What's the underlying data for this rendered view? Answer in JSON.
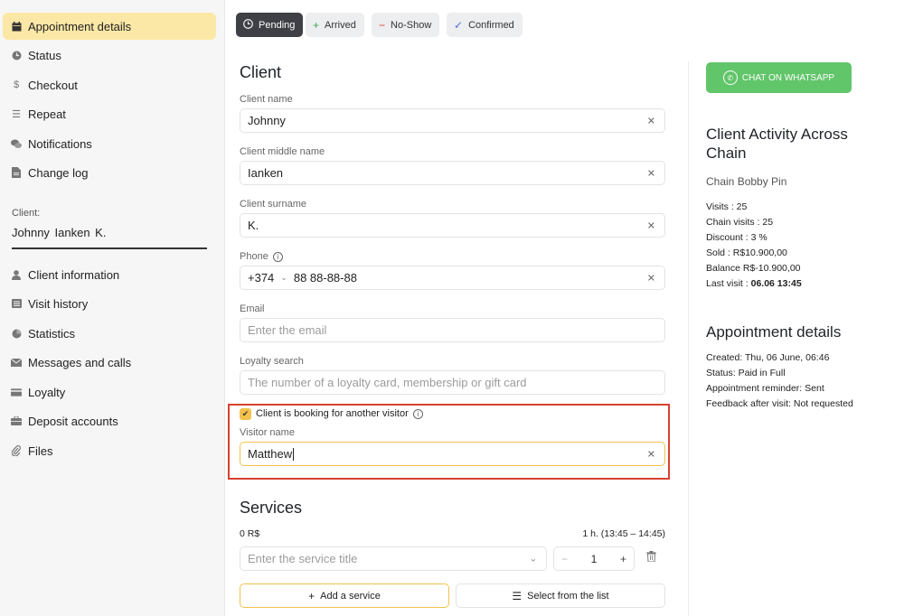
{
  "sidebar": {
    "items": [
      {
        "label": "Appointment details",
        "icon": "calendar-icon"
      },
      {
        "label": "Status",
        "icon": "clock-icon"
      },
      {
        "label": "Checkout",
        "icon": "dollar-icon"
      },
      {
        "label": "Repeat",
        "icon": "list-icon"
      },
      {
        "label": "Notifications",
        "icon": "chat-bubbles-icon"
      },
      {
        "label": "Change log",
        "icon": "document-icon"
      }
    ],
    "client_caption": "Client:",
    "client_name": "Johnny  Ianken K.",
    "client_items": [
      {
        "label": "Client information",
        "icon": "user-icon"
      },
      {
        "label": "Visit history",
        "icon": "history-icon"
      },
      {
        "label": "Statistics",
        "icon": "pie-chart-icon"
      },
      {
        "label": "Messages and calls",
        "icon": "envelope-icon"
      },
      {
        "label": "Loyalty",
        "icon": "card-icon"
      },
      {
        "label": "Deposit accounts",
        "icon": "briefcase-icon"
      },
      {
        "label": "Files",
        "icon": "paperclip-icon"
      }
    ]
  },
  "status_buttons": [
    {
      "label": "Pending",
      "icon": "clock-icon",
      "active": true
    },
    {
      "label": "Arrived",
      "icon": "plus-icon"
    },
    {
      "label": "No-Show",
      "icon": "minus-icon"
    },
    {
      "label": "Confirmed",
      "icon": "check-icon"
    }
  ],
  "colors": {
    "accent": "#f2c14e",
    "active_nav": "#fbe8a6",
    "whatsapp": "#61c56a",
    "highlight": "#d9412f"
  },
  "client": {
    "title": "Client",
    "name_label": "Client name",
    "name_value": "Johnny",
    "middle_label": "Client middle name",
    "middle_value": "Ianken",
    "surname_label": "Client surname",
    "surname_value": "K.",
    "phone_label": "Phone",
    "phone_code": "+374",
    "phone_value": "88 88-88-88",
    "email_label": "Email",
    "email_placeholder": "Enter the email",
    "loyalty_label": "Loyalty search",
    "loyalty_placeholder": "The number of a loyalty card, membership or gift card",
    "another_visitor_label": "Client is booking for another visitor",
    "visitor_label": "Visitor name",
    "visitor_value": "Matthew"
  },
  "services": {
    "title": "Services",
    "price": "0 R$",
    "duration": "1 h. (13:45 – 14:45)",
    "service_placeholder": "Enter the service title",
    "quantity": "1",
    "add_label": "Add a service",
    "list_label": "Select from the list"
  },
  "right_panel": {
    "whatsapp_label": "CHAT ON WHATSAPP",
    "activity_title": "Client Activity Across Chain",
    "chain_name": "Chain Bobby Pin",
    "visits": "Visits : 25",
    "chain_visits": "Chain visits : 25",
    "discount": "Discount : 3 %",
    "sold": "Sold : R$10.900,00",
    "balance": "Balance R$-10.900,00",
    "last_visit_label": "Last visit : ",
    "last_visit_value": "06.06 13:45",
    "details_title": "Appointment details",
    "created": "Created: Thu, 06 June, 06:46",
    "status": "Status: Paid in Full",
    "reminder": "Appointment reminder: Sent",
    "feedback": "Feedback after visit: Not requested"
  }
}
